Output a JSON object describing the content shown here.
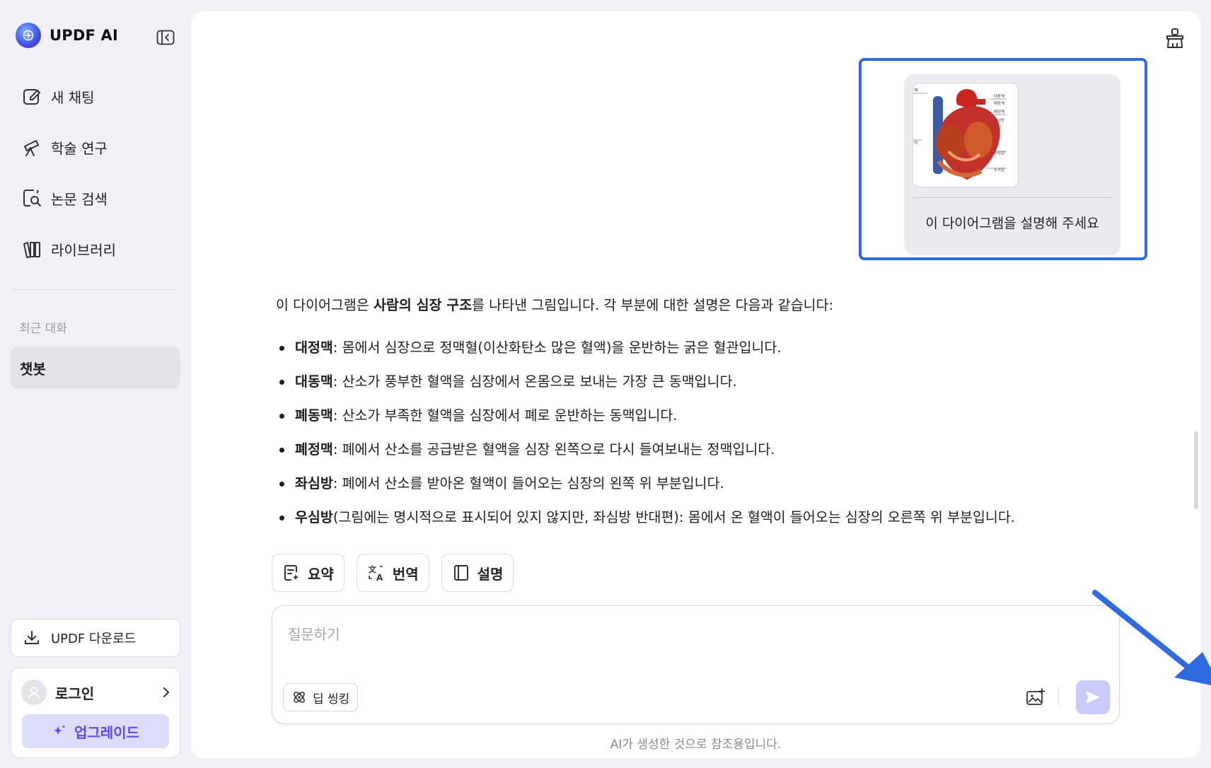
{
  "app": {
    "name": "UPDF AI"
  },
  "sidebar": {
    "nav": [
      {
        "label": "새 채팅"
      },
      {
        "label": "학술 연구"
      },
      {
        "label": "논문 검색"
      },
      {
        "label": "라이브러리"
      }
    ],
    "recent_label": "최근 대화",
    "recent_items": [
      {
        "label": "챗봇"
      }
    ],
    "download_label": "UPDF 다운로드",
    "login_label": "로그인",
    "upgrade_label": "업그레이드"
  },
  "chat": {
    "user_message": "이 다이어그램을 설명해 주세요",
    "heart_labels": {
      "left_top": "맥",
      "left_mid": "막",
      "right": [
        "대동맥",
        "폐동맥",
        "폐정맥",
        "좌심방",
        "좌심실",
        "두꺼운"
      ]
    },
    "answer": {
      "intro_before": "이 다이어그램은 ",
      "intro_bold": "사람의 심장 구조",
      "intro_after": "를 나타낸 그림입니다. 각 부분에 대한 설명은 다음과 같습니다:",
      "items": [
        {
          "term": "대정맥",
          "text": ": 몸에서 심장으로 정맥혈(이산화탄소 많은 혈액)을 운반하는 굵은 혈관입니다."
        },
        {
          "term": "대동맥",
          "text": ": 산소가 풍부한 혈액을 심장에서 온몸으로 보내는 가장 큰 동맥입니다."
        },
        {
          "term": "폐동맥",
          "text": ": 산소가 부족한 혈액을 심장에서 폐로 운반하는 동맥입니다."
        },
        {
          "term": "폐정맥",
          "text": ": 폐에서 산소를 공급받은 혈액을 심장 왼쪽으로 다시 들여보내는 정맥입니다."
        },
        {
          "term": "좌심방",
          "text": ": 폐에서 산소를 받아온 혈액이 들어오는 심장의 왼쪽 위 부분입니다."
        },
        {
          "term": "우심방",
          "text": "(그림에는 명시적으로 표시되어 있지 않지만, 좌심방 반대편): 몸에서 온 혈액이 들어오는 심장의 오른쪽 위 부분입니다."
        }
      ]
    },
    "quick_actions": [
      {
        "label": "요약"
      },
      {
        "label": "번역"
      },
      {
        "label": "설명"
      }
    ],
    "input": {
      "placeholder": "질문하기",
      "value": "",
      "deep_thinking_label": "딥 씽킹"
    },
    "disclaimer": "AI가 생성한 것으로 참조용입니다."
  },
  "colors": {
    "accent": "#5a4cf0",
    "highlight_frame": "#2f6ae0",
    "arrow": "#2f6ae0",
    "send_button": "#c9cbfa"
  }
}
